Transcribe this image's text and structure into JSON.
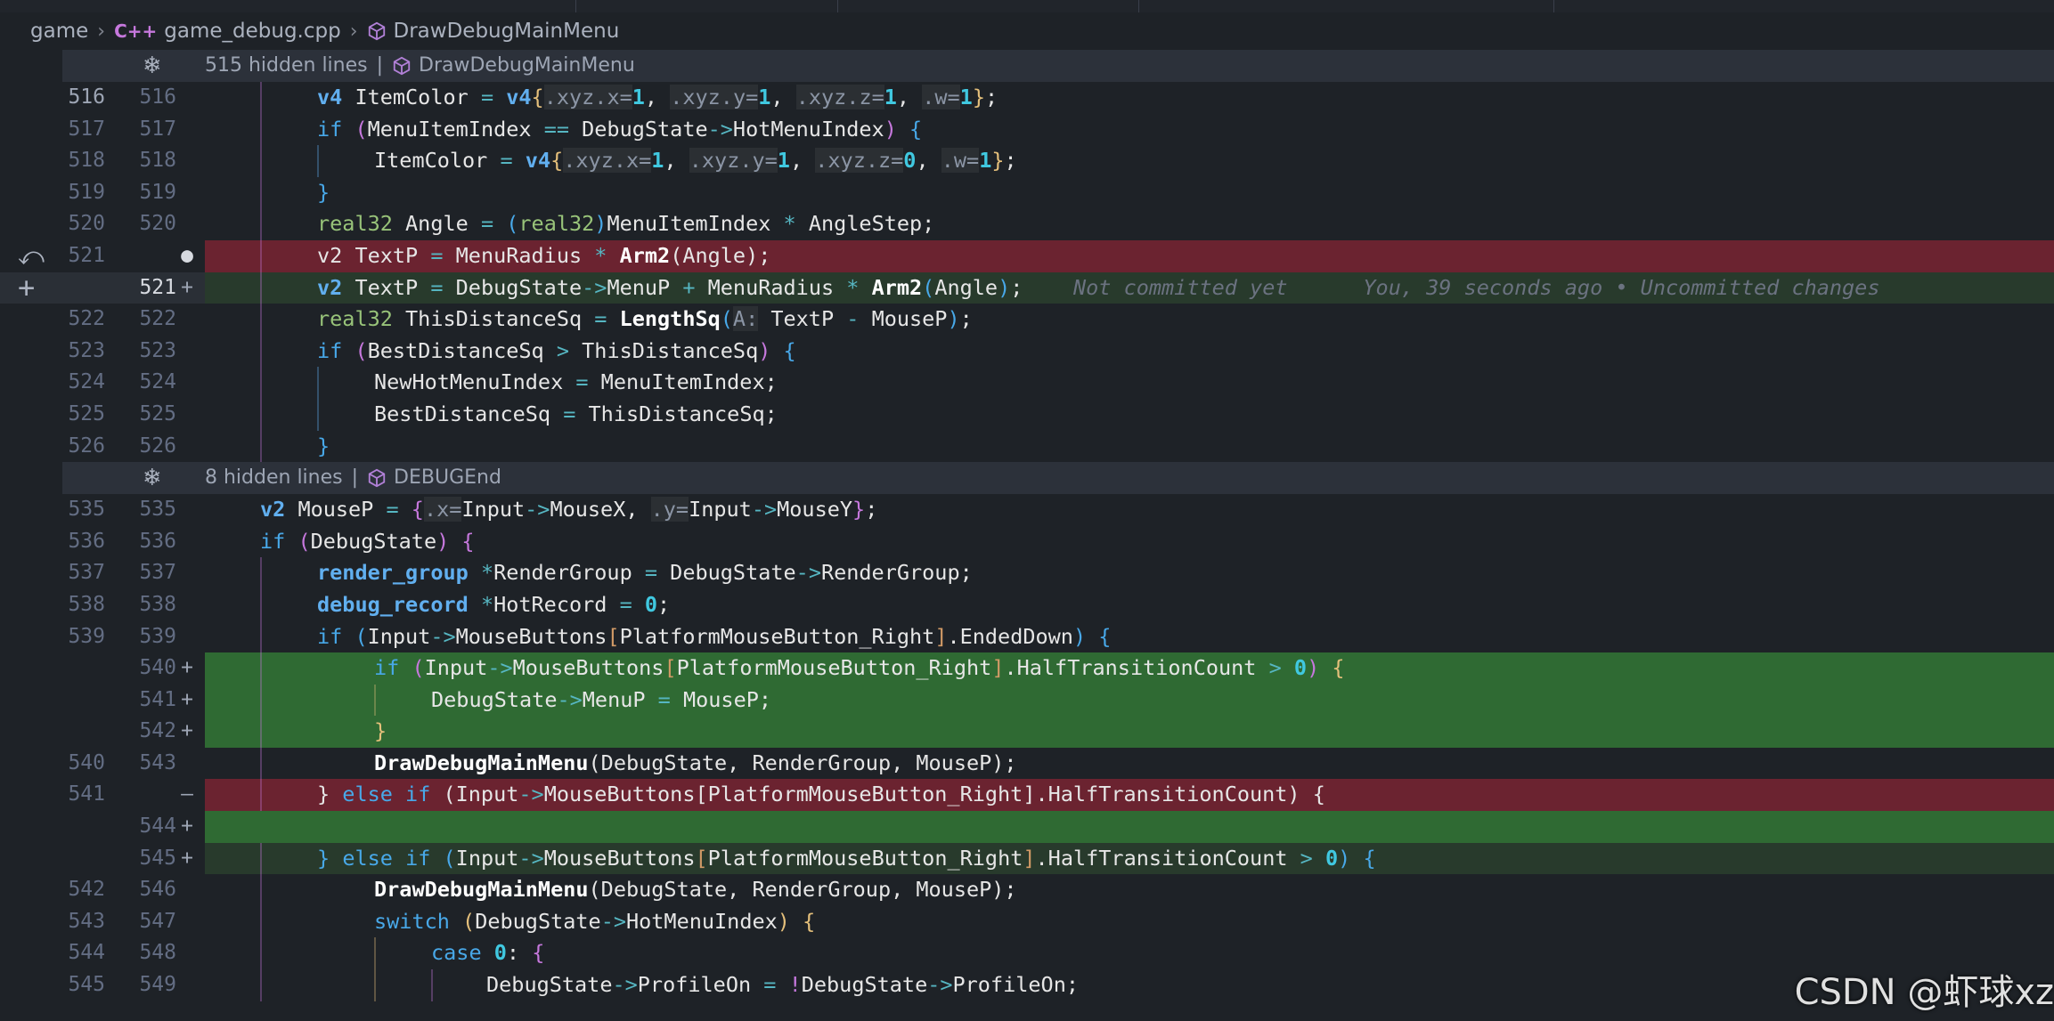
{
  "breadcrumb": {
    "folder": "game",
    "file_icon_label": "C++",
    "file": "game_debug.cpp",
    "symbol": "DrawDebugMainMenu"
  },
  "folds": [
    {
      "count": "515 hidden lines",
      "symbol": "DrawDebugMainMenu"
    },
    {
      "count": "8 hidden lines",
      "symbol": "DEBUGEnd"
    }
  ],
  "blame": {
    "text": "Not committed yet",
    "author": "You, 39 seconds ago • Uncommitted changes"
  },
  "lines": {
    "l516": {
      "a": "516",
      "b": "516"
    },
    "l517": {
      "a": "517",
      "b": "517"
    },
    "l518": {
      "a": "518",
      "b": "518"
    },
    "l519": {
      "a": "519",
      "b": "519"
    },
    "l520": {
      "a": "520",
      "b": "520"
    },
    "l521d": {
      "a": "521",
      "b": ""
    },
    "l521a": {
      "a": "",
      "b": "521"
    },
    "l522": {
      "a": "522",
      "b": "522"
    },
    "l523": {
      "a": "523",
      "b": "523"
    },
    "l524": {
      "a": "524",
      "b": "524"
    },
    "l525": {
      "a": "525",
      "b": "525"
    },
    "l526": {
      "a": "526",
      "b": "526"
    },
    "l535": {
      "a": "535",
      "b": "535"
    },
    "l536": {
      "a": "536",
      "b": "536"
    },
    "l537": {
      "a": "537",
      "b": "537"
    },
    "l538": {
      "a": "538",
      "b": "538"
    },
    "l539": {
      "a": "539",
      "b": "539"
    },
    "l540a": {
      "a": "",
      "b": "540"
    },
    "l541a": {
      "a": "",
      "b": "541"
    },
    "l542a": {
      "a": "",
      "b": "542"
    },
    "l543": {
      "a": "540",
      "b": "543"
    },
    "l541d": {
      "a": "541",
      "b": ""
    },
    "l544a": {
      "a": "",
      "b": "544"
    },
    "l545a": {
      "a": "",
      "b": "545"
    },
    "l546": {
      "a": "542",
      "b": "546"
    },
    "l547": {
      "a": "543",
      "b": "547"
    },
    "l548": {
      "a": "544",
      "b": "548"
    },
    "l549": {
      "a": "545",
      "b": "549"
    }
  },
  "markers": {
    "add": "+",
    "del": "—"
  },
  "watermark": "CSDN @虾球xz",
  "colors": {
    "deleted_bg": "#6b2330",
    "added_bg": "#2f6a33"
  }
}
